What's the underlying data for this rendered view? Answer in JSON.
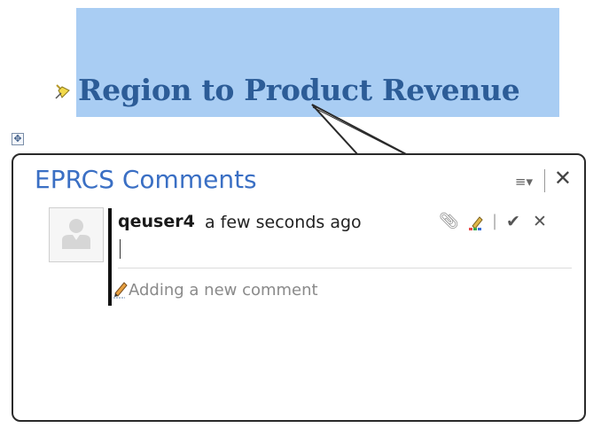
{
  "document": {
    "heading": "Region to Product Revenue"
  },
  "comments_panel": {
    "title": "EPRCS Comments",
    "menu_icon": "hamburger-dropdown-icon",
    "close_icon": "close-icon",
    "comment": {
      "author": "qeuser4",
      "timestamp": "a few seconds ago",
      "input_value": "",
      "actions": [
        "paperclip-icon",
        "highlighter-icon",
        "checkmark-icon",
        "close-icon"
      ]
    },
    "new_comment_prompt": "Adding a new comment"
  },
  "colors": {
    "heading_text": "#2c5c97",
    "heading_highlight": "#a9cdf3",
    "panel_title": "#3a6fc4"
  }
}
